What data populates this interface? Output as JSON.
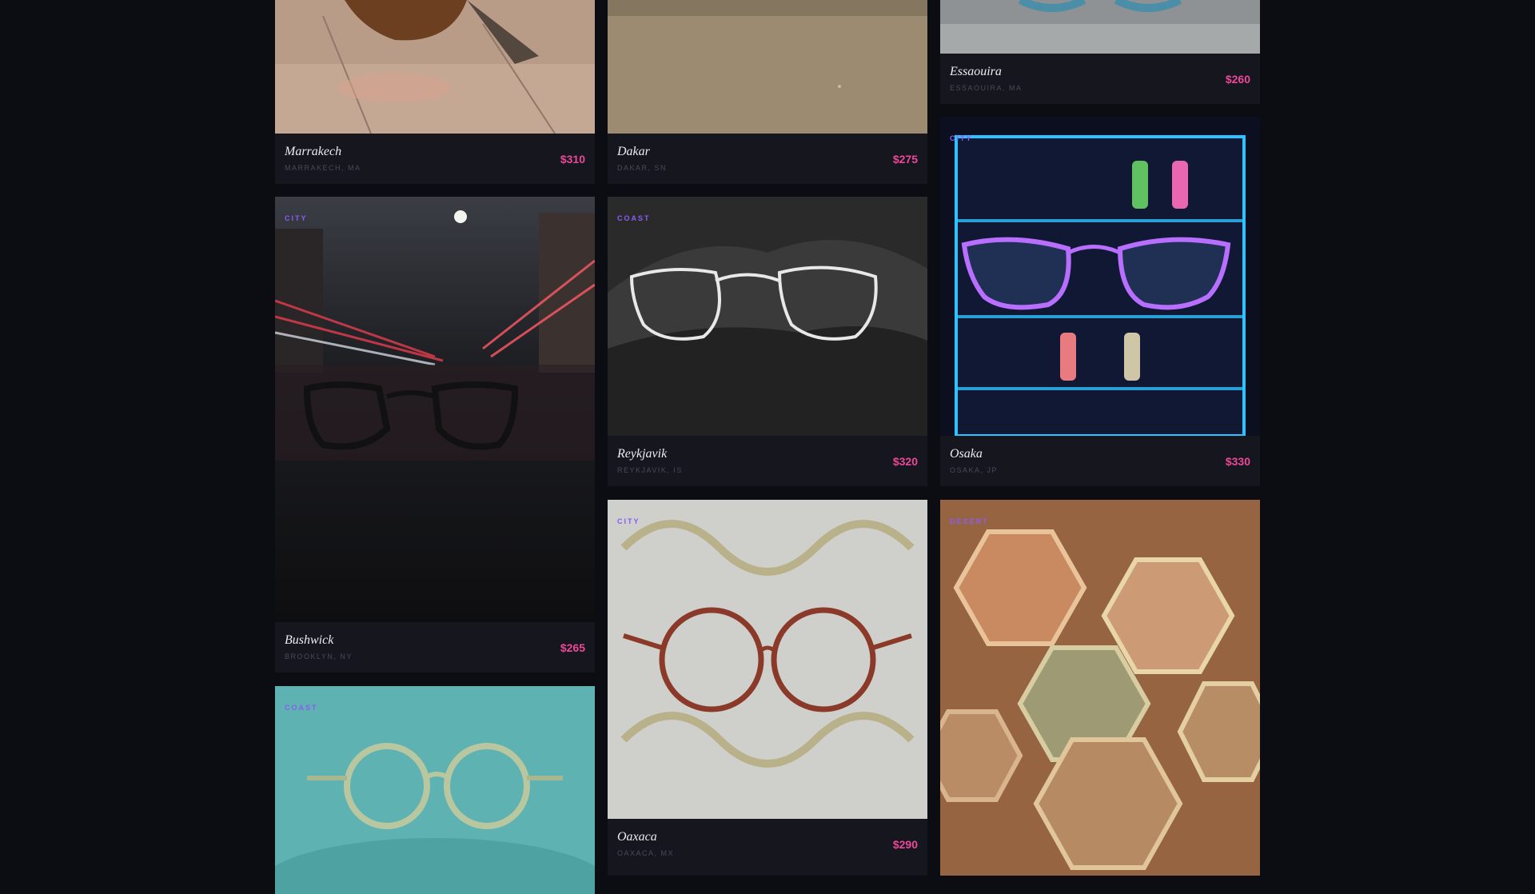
{
  "theme": {
    "background": "#0c0c13",
    "card": "#16161f",
    "accent_price": "#ec4899",
    "accent_category": "#8b5cf6"
  },
  "products": [
    {
      "name": "Marrakech",
      "location": "MARRAKECH, MA",
      "price": "$310",
      "category": "",
      "image_icon": "tortoiseshell-sunglasses-on-tile-image"
    },
    {
      "name": "Dakar",
      "location": "DAKAR, SN",
      "price": "$275",
      "category": "",
      "image_icon": "glasses-on-sand-image"
    },
    {
      "name": "Essaouira",
      "location": "ESSAOUIRA, MA",
      "price": "$260",
      "category": "",
      "image_icon": "blue-sunglasses-image"
    },
    {
      "name": "Bushwick",
      "location": "BROOKLYN, NY",
      "price": "$265",
      "category": "CITY",
      "image_icon": "black-glasses-wet-street-image"
    },
    {
      "name": "Reykjavik",
      "location": "REYKJAVIK, IS",
      "price": "$320",
      "category": "COAST",
      "image_icon": "clear-glasses-lava-rock-image"
    },
    {
      "name": "Osaka",
      "location": "OSAKA, JP",
      "price": "$330",
      "category": "CITY",
      "image_icon": "neon-glasses-vending-image"
    },
    {
      "name": "Oaxaca",
      "location": "OAXACA, MX",
      "price": "$290",
      "category": "CITY",
      "image_icon": "red-glasses-embroidery-image"
    },
    {
      "name": "",
      "location": "",
      "price": "",
      "category": "DESERT",
      "image_icon": "hexagon-frames-table-image"
    },
    {
      "name": "",
      "location": "",
      "price": "",
      "category": "COAST",
      "image_icon": "green-glasses-water-image"
    }
  ]
}
